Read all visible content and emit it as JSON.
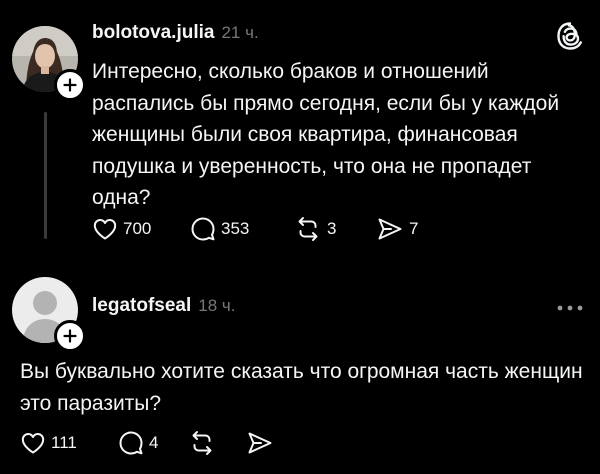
{
  "posts": [
    {
      "username": "bolotova.julia",
      "time": "21 ч.",
      "text": "Интересно, сколько браков и отношений распались бы прямо сегодня, если бы у каждой женщины были своя квартира, финансовая подушка и уверенность, что она не пропадет одна?",
      "likes": "700",
      "replies": "353",
      "reposts": "3",
      "shares": "7"
    },
    {
      "username": "legatofseal",
      "time": "18 ч.",
      "text": "Вы буквально хотите сказать что огромная часть женщин это паразиты?",
      "likes": "111",
      "replies": "4"
    }
  ],
  "icons": {
    "header_right": "threads-logo-icon",
    "overflow": "more-horizontal-icon",
    "like": "heart-icon",
    "reply": "speech-bubble-icon",
    "repost": "repost-icon",
    "share": "send-icon",
    "follow": "plus-icon"
  },
  "colors": {
    "background": "#000000",
    "text": "#f3f5f7",
    "secondary_text": "#777777",
    "thread_line": "#3a3a3a"
  }
}
